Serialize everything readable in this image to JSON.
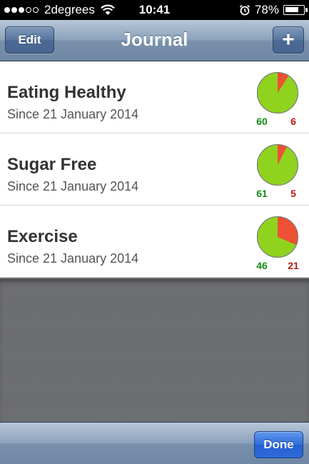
{
  "status_bar": {
    "signal_dots": [
      true,
      true,
      true,
      false,
      false
    ],
    "carrier": "2degrees",
    "time": "10:41",
    "battery": "78%",
    "battery_level": 0.78,
    "icons": [
      "wifi-icon",
      "alarm-clock-icon",
      "battery-icon"
    ]
  },
  "nav": {
    "title": "Journal",
    "edit_label": "Edit",
    "add_label": "+"
  },
  "colors": {
    "good": "#8fd31f",
    "bad": "#ee5035",
    "good_text": "#178a17",
    "bad_text": "#b81717"
  },
  "habits": [
    {
      "name": "Eating Healthy",
      "since": "Since 21 January 2014",
      "good": 60,
      "bad": 6
    },
    {
      "name": "Sugar Free",
      "since": "Since 21 January 2014",
      "good": 61,
      "bad": 5
    },
    {
      "name": "Exercise",
      "since": "Since 21 January 2014",
      "good": 46,
      "bad": 21
    }
  ],
  "toolbar": {
    "done_label": "Done"
  }
}
